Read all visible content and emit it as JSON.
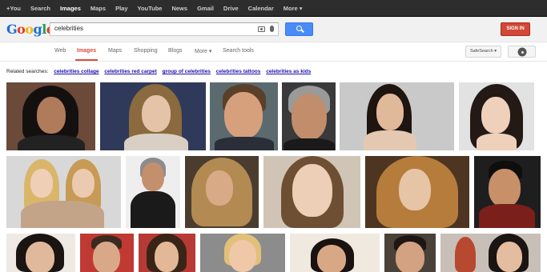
{
  "topbar": {
    "items": [
      "+You",
      "Search",
      "Images",
      "Maps",
      "Play",
      "YouTube",
      "News",
      "Gmail",
      "Drive",
      "Calendar",
      "More ▾"
    ],
    "active_index": 2
  },
  "header": {
    "logo": "Google",
    "query": "celebrities",
    "signin_label": "SIGN IN"
  },
  "tabs": {
    "items": [
      "Web",
      "Images",
      "Maps",
      "Shopping",
      "Blogs",
      "More ▾",
      "Search tools"
    ],
    "active_index": 1,
    "safesearch_label": "SafeSearch ▾"
  },
  "related": {
    "label": "Related searches:",
    "links": [
      "celebrities collage",
      "celebrities red carpet",
      "group of celebrities",
      "celebrities tattoos",
      "celebrities as kids"
    ]
  },
  "colors": {
    "accent_red": "#dd4b39",
    "search_blue": "#4a8cf7",
    "link_blue": "#1a0dab",
    "topbar_bg": "#2d2d2d"
  },
  "results": {
    "row_count": 3,
    "thumbnails": 19
  }
}
